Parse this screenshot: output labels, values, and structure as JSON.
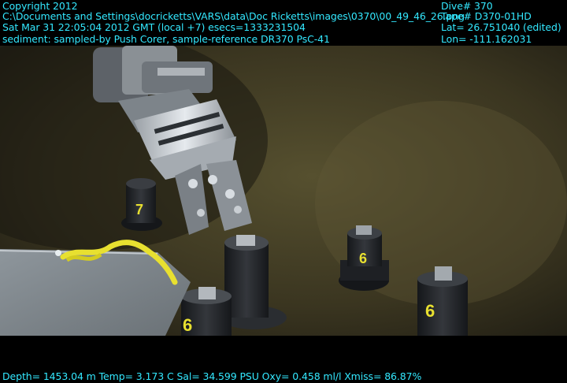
{
  "header": {
    "copyright": "Copyright 2012",
    "file_path": "C:\\Documents and Settings\\docricketts\\VARS\\data\\Doc Ricketts\\images\\0370\\00_49_46_26.png",
    "datetime": "Sat Mar 31 22:05:04 2012 GMT (local +7)  esecs=1333231504",
    "annotation": "sediment: sampled-by Push Corer, sample-reference DR370 PsC-41"
  },
  "navigation": {
    "dive": "Dive# 370",
    "tape": "Tape# D370-01HD",
    "lat": "Lat= 26.751040 (edited)",
    "lon": "Lon= -111.162031"
  },
  "sensors": {
    "line": "Depth= 1453.04 m  Temp= 3.173 C  Sal= 34.599 PSU  Oxy= 0.458 ml/l  Xmiss= 86.87%"
  },
  "corer_labels": [
    "7",
    "6",
    "6",
    "6"
  ],
  "colors": {
    "overlay_text": "#33e8ff",
    "sediment": "#3a3520",
    "corer_body": "#23262a",
    "marker_yellow": "#e8e030"
  }
}
